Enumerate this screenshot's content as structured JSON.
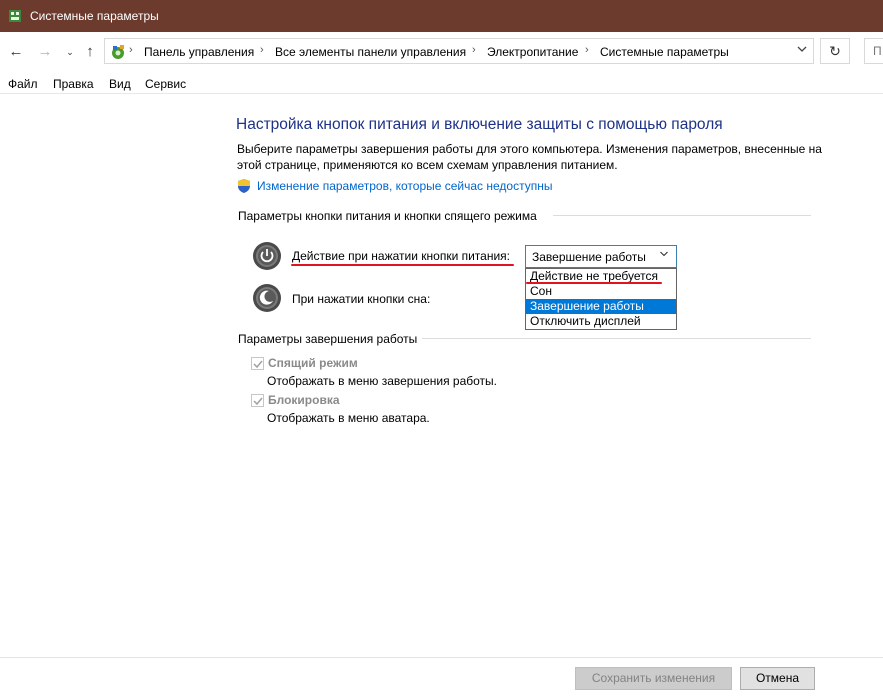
{
  "window": {
    "title": "Системные параметры"
  },
  "address": {
    "crumbs": [
      "Панель управления",
      "Все элементы панели управления",
      "Электропитание",
      "Системные параметры"
    ],
    "search_placeholder": "П"
  },
  "menu": [
    "Файл",
    "Правка",
    "Вид",
    "Сервис"
  ],
  "main": {
    "heading": "Настройка кнопок питания и включение защиты с помощью пароля",
    "description": "Выберите параметры завершения работы для этого компьютера. Изменения параметров, внесенные на этой странице, применяются ко всем схемам управления питанием.",
    "change_link": "Изменение параметров, которые сейчас недоступны"
  },
  "power_buttons_group": {
    "title": "Параметры кнопки питания и кнопки спящего режима",
    "power_label": "Действие при нажатии кнопки питания:",
    "power_value": "Завершение работы",
    "sleep_label": "При нажатии кнопки сна:",
    "options": [
      "Действие не требуется",
      "Сон",
      "Завершение работы",
      "Отключить дисплей"
    ],
    "selected_option": "Завершение работы"
  },
  "shutdown_group": {
    "title": "Параметры завершения работы",
    "items": [
      {
        "label": "Спящий режим",
        "description": "Отображать в меню завершения работы.",
        "checked": true
      },
      {
        "label": "Блокировка",
        "description": "Отображать в меню аватара.",
        "checked": true
      }
    ]
  },
  "footer": {
    "save_label": "Сохранить изменения",
    "cancel_label": "Отмена"
  },
  "colors": {
    "titlebar": "#6d3a2e",
    "heading": "#1e3287",
    "link": "#0066cc",
    "highlight": "#0078d7",
    "annotation": "#e0141e"
  }
}
